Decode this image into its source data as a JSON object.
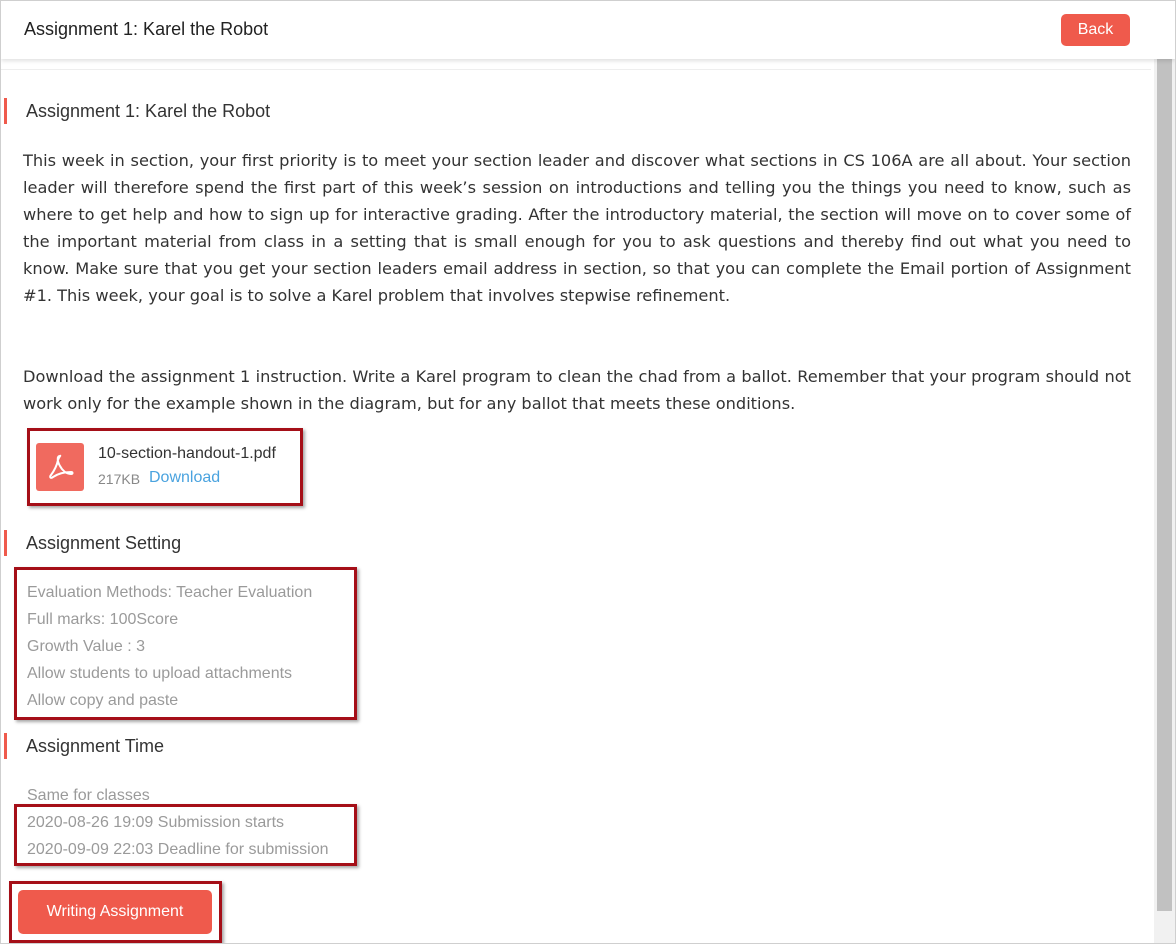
{
  "header": {
    "title": "Assignment 1: Karel the Robot",
    "back_label": "Back"
  },
  "assignment": {
    "heading": "Assignment 1: Karel the Robot",
    "description": "This week in section, your first priority is to meet your section leader and discover what sections in CS 106A are all about. Your section leader will therefore spend the first part of this week’s session on introductions and telling you the things you need to know, such as where to get help and how to sign up for interactive grading. After the introductory material, the section will move on to cover some of the important material from class in a setting that is small enough for you to ask questions and thereby find out what you need to know. Make sure that you get your section leaders email address in section, so that you can complete the Email portion of Assignment #1. This week, your goal is to solve a Karel problem that involves stepwise refinement.",
    "instruction": "Download the assignment 1 instruction. Write a Karel program to clean the chad from a ballot. Remember that your program should not work only for the example shown in the diagram, but for any ballot that meets these onditions.",
    "attachment": {
      "icon": "pdf-icon",
      "filename": "10-section-handout-1.pdf",
      "size": "217KB",
      "download_label": "Download"
    }
  },
  "settings": {
    "heading": "Assignment Setting",
    "evaluation": "Evaluation Methods:   Teacher Evaluation",
    "full_marks": "Full marks:  100Score",
    "growth_value": "Growth Value :  3",
    "upload": "Allow students to upload attachments",
    "copy_paste": "Allow copy and paste"
  },
  "time": {
    "heading": "Assignment Time",
    "same_for_classes": "Same for classes",
    "start": "2020-08-26 19:09 Submission starts",
    "deadline": "2020-09-09 22:03 Deadline for submission"
  },
  "actions": {
    "write_label": "Writing Assignment"
  },
  "colors": {
    "accent": "#ef5a4c",
    "highlight_box": "#a50f18",
    "link": "#4aa3df"
  }
}
